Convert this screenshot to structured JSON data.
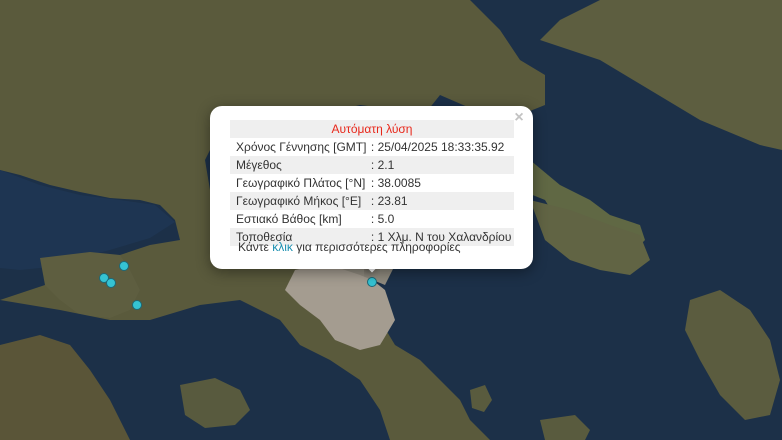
{
  "map": {
    "colors": {
      "sea": "#1c3048",
      "land": "#5a5a3c",
      "urban": "#a49c90",
      "marker": "#35c3d3"
    },
    "markers": [
      {
        "name": "quake-marker-selected",
        "selected": true
      },
      {
        "name": "quake-marker-1",
        "selected": false
      },
      {
        "name": "quake-marker-2",
        "selected": false
      },
      {
        "name": "quake-marker-3",
        "selected": false
      },
      {
        "name": "quake-marker-4",
        "selected": false
      }
    ]
  },
  "popup": {
    "title": "Αυτόματη λύση",
    "close_icon": "×",
    "rows": [
      {
        "label": "Χρόνος Γέννησης [GMT]",
        "value": ": 25/04/2025 18:33:35.92"
      },
      {
        "label": "Μέγεθος",
        "value": ": 2.1"
      },
      {
        "label": "Γεωγραφικό Πλάτος [°N]",
        "value": ": 38.0085"
      },
      {
        "label": "Γεωγραφικό Μήκος [°E]",
        "value": ": 23.81"
      },
      {
        "label": "Εστιακό Βάθος [km]",
        "value": ": 5.0"
      },
      {
        "label": "Τοποθεσία",
        "value": ": 1 Χλμ. Ν του Χαλανδρίου"
      }
    ],
    "footer": {
      "prefix": "Κάντε ",
      "link": "κλικ",
      "suffix": " για περισσότερες πληροφορίες"
    }
  }
}
